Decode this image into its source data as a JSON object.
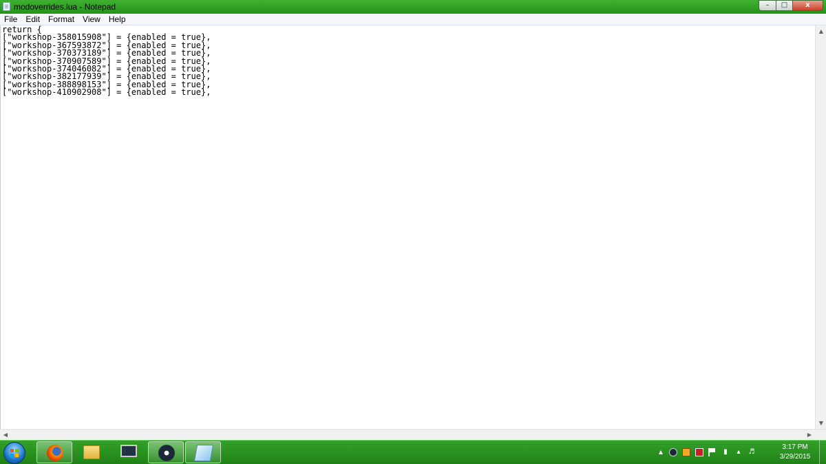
{
  "window": {
    "title": "modoverrides.lua - Notepad",
    "controls": {
      "minimize": "–",
      "maximize": "□",
      "close": "x"
    }
  },
  "menu": {
    "items": [
      "File",
      "Edit",
      "Format",
      "View",
      "Help"
    ]
  },
  "editor": {
    "lines": [
      "return {",
      "[\"workshop-358015908\"] = {enabled = true},",
      "[\"workshop-367593872\"] = {enabled = true},",
      "[\"workshop-370373189\"] = {enabled = true},",
      "[\"workshop-370907589\"] = {enabled = true},",
      "[\"workshop-374046082\"] = {enabled = true},",
      "[\"workshop-382177939\"] = {enabled = true},",
      "[\"workshop-388898153\"] = {enabled = true},",
      "[\"workshop-410902908\"] = {enabled = true},"
    ]
  },
  "scrollbars": {
    "up_arrow": "▲",
    "down_arrow": "▼",
    "left_arrow": "◀",
    "right_arrow": "▶"
  },
  "taskbar": {
    "pinned": [
      {
        "icon": "firefox-icon",
        "active": true
      },
      {
        "icon": "folder-icon",
        "active": false
      },
      {
        "icon": "monitor-icon",
        "active": false
      },
      {
        "icon": "steam-icon",
        "active": true
      },
      {
        "icon": "notepad-icon",
        "active": true
      }
    ],
    "tray": {
      "show_hidden": "▲"
    },
    "clock": {
      "time": "3:17 PM",
      "date": "3/29/2015"
    }
  },
  "colors": {
    "title_bar": "#2fa325",
    "taskbar": "#2a9620",
    "editor_bg": "#ffffff"
  }
}
